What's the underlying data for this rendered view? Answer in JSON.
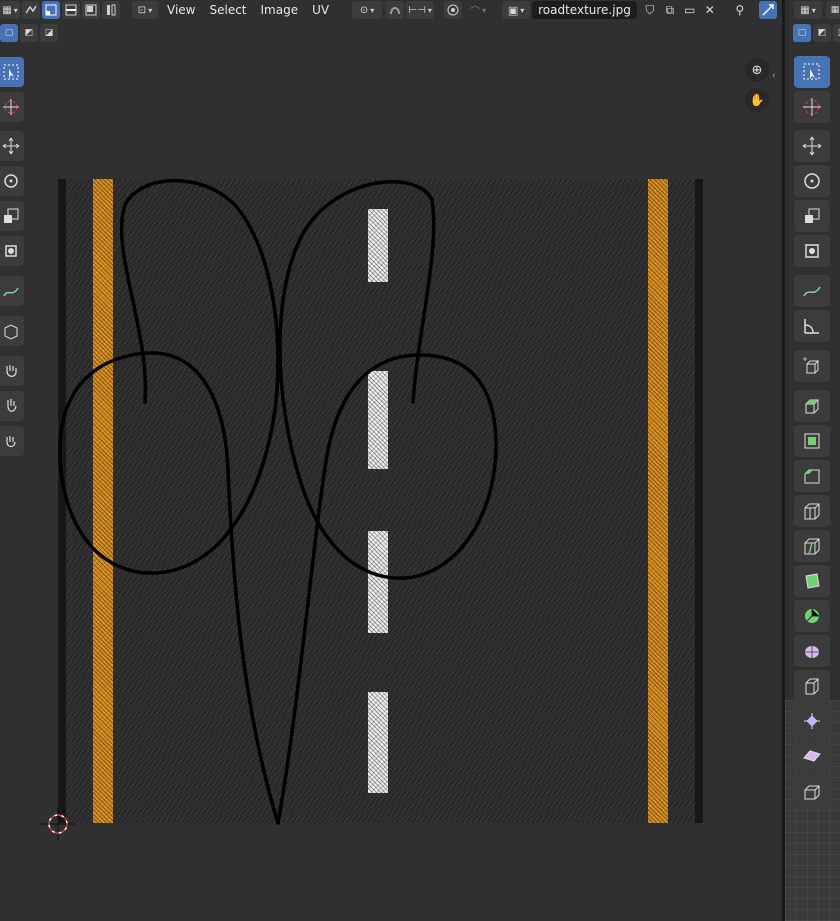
{
  "header": {
    "menus": [
      "View",
      "Select",
      "Image",
      "UV"
    ],
    "image_name": "roadtexture.jpg"
  },
  "tools_left": [
    "select-box-icon",
    "cursor-icon",
    "move-icon",
    "rotate-icon",
    "scale-icon",
    "transform-icon",
    "annotate-icon",
    "rip-icon",
    "grab-icon",
    "relax-icon",
    "pinch-icon"
  ],
  "tools_right": [
    "select-box-icon",
    "cursor-icon",
    "move-icon",
    "rotate-icon",
    "scale-icon",
    "transform-icon",
    "annotate-icon",
    "measure-icon",
    "add-cube-icon",
    "extrude-icon",
    "inset-icon",
    "bevel-icon",
    "loop-cut-icon",
    "knife-icon",
    "poly-build-icon",
    "spin-icon",
    "smooth-icon",
    "edge-slide-icon",
    "shrink-fatten-icon",
    "shear-icon",
    "rip-region-icon"
  ],
  "colors": {
    "accent": "#4772b3",
    "panel": "#303030",
    "road_yellow": "#d28a1c",
    "road_dash": "#efefef",
    "annotation_stroke": "#000000"
  }
}
